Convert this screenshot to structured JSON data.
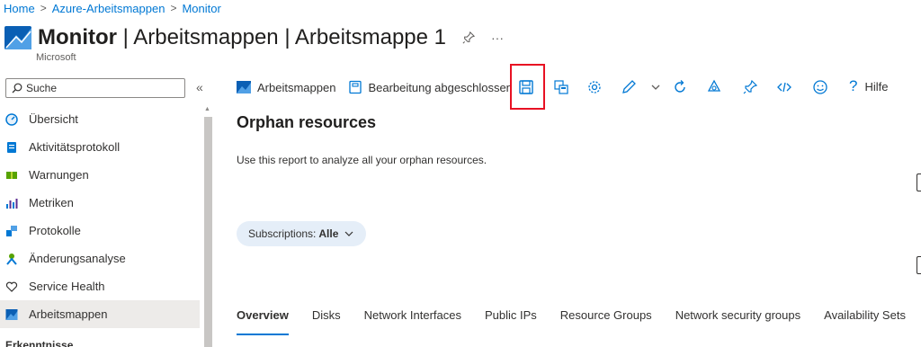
{
  "breadcrumb": [
    "Home",
    "Azure-Arbeitsmappen",
    "Monitor"
  ],
  "header": {
    "title_bold": "Monitor",
    "title_rest": " | Arbeitsmappen | Arbeitsmappe 1",
    "subtitle": "Microsoft"
  },
  "sidebar": {
    "search_placeholder": "Suche",
    "items": [
      {
        "label": "Übersicht",
        "icon": "overview-icon"
      },
      {
        "label": "Aktivitätsprotokoll",
        "icon": "activity-log-icon"
      },
      {
        "label": "Warnungen",
        "icon": "alerts-icon"
      },
      {
        "label": "Metriken",
        "icon": "metrics-icon"
      },
      {
        "label": "Protokolle",
        "icon": "logs-icon"
      },
      {
        "label": "Änderungsanalyse",
        "icon": "change-analysis-icon"
      },
      {
        "label": "Service Health",
        "icon": "heart-icon"
      },
      {
        "label": "Arbeitsmappen",
        "icon": "workbooks-icon",
        "active": true
      }
    ],
    "section_label": "Erkenntnisse"
  },
  "toolbar": {
    "workbooks_label": "Arbeitsmappen",
    "done_editing_label": "Bearbeitung abgeschlossen",
    "help_label": "Hilfe"
  },
  "content": {
    "title": "Orphan resources",
    "description": "Use this report to analyze all your orphan resources.",
    "filter_label": "Subscriptions:",
    "filter_value": "Alle",
    "tabs": [
      "Overview",
      "Disks",
      "Network Interfaces",
      "Public IPs",
      "Resource Groups",
      "Network security groups",
      "Availability Sets"
    ]
  },
  "colors": {
    "accent": "#0078d4",
    "highlight": "#e81123",
    "active_nav_bg": "#edebe9",
    "pill_bg": "#e5eef8"
  }
}
